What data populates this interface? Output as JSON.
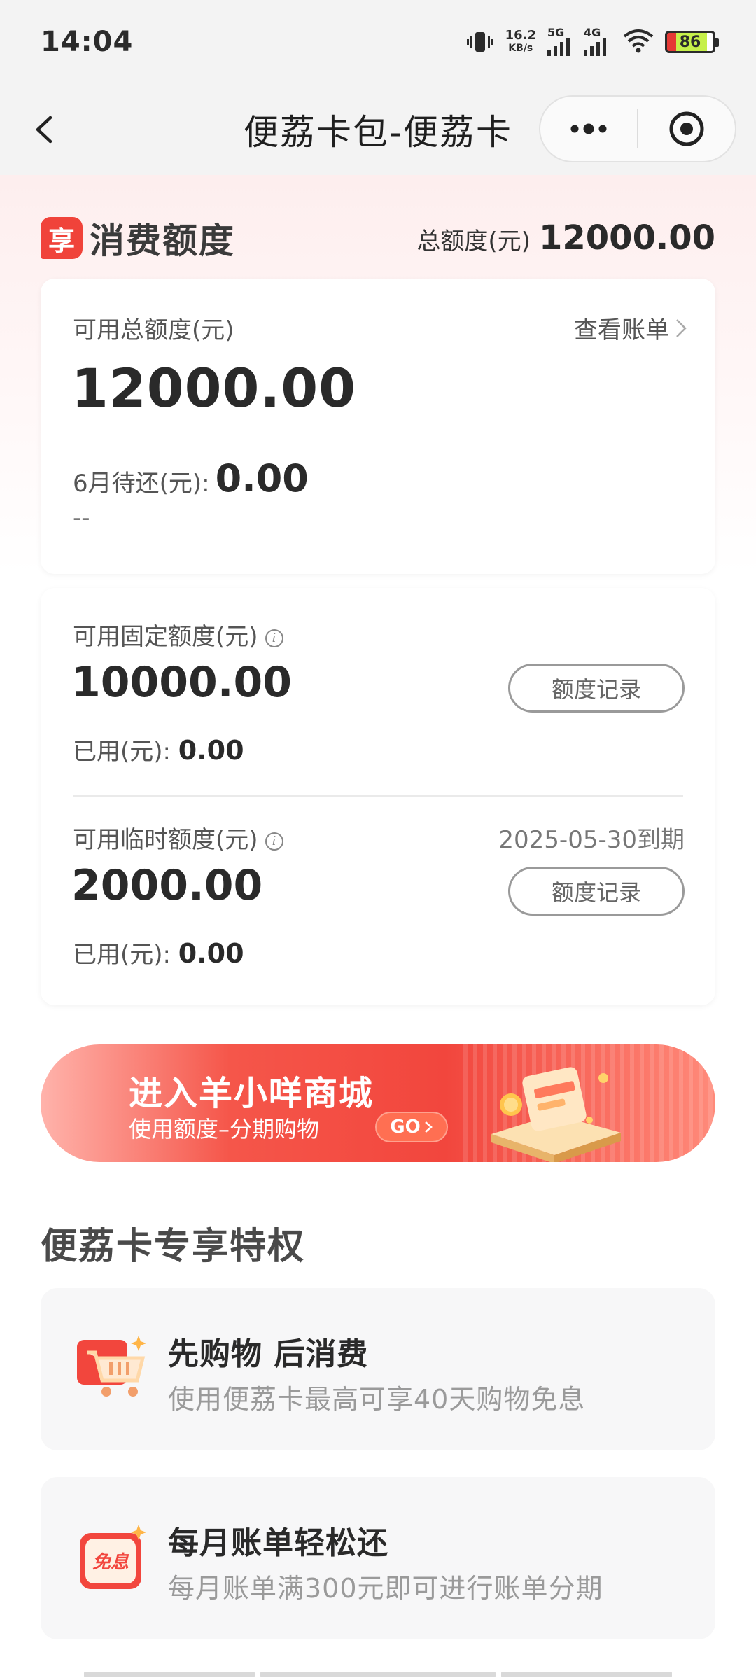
{
  "status": {
    "time": "14:04",
    "net_speed_top": "16.2",
    "net_speed_bottom": "KB/s",
    "sig1_label": "5G",
    "sig2_label": "4G",
    "battery": "86"
  },
  "nav": {
    "title": "便荔卡包-便荔卡",
    "icons": {
      "back": "chevron-left-icon",
      "more": "more-dots-icon",
      "close": "target-icon"
    }
  },
  "quota": {
    "logo": "享",
    "title": "消费额度",
    "total_label": "总额度(元)",
    "total_value": "12000.00"
  },
  "card1": {
    "available_label": "可用总额度(元)",
    "available_value": "12000.00",
    "bill_link": "查看账单",
    "due_label": "6月待还(元):",
    "due_value": "0.00",
    "due_sub": "--"
  },
  "fixed": {
    "label": "可用固定额度(元)",
    "value": "10000.00",
    "record_btn": "额度记录",
    "used_label": "已用(元):",
    "used_value": "0.00"
  },
  "temp": {
    "label": "可用临时额度(元)",
    "value": "2000.00",
    "expire": "2025-05-30到期",
    "record_btn": "额度记录",
    "used_label": "已用(元):",
    "used_value": "0.00"
  },
  "banner": {
    "title": "进入羊小咩商城",
    "subtitle": "使用额度–分期购物",
    "go": "GO"
  },
  "privileges": {
    "title": "便荔卡专享特权",
    "items": [
      {
        "title": "先购物 后消费",
        "desc": "使用便荔卡最高可享40天购物免息",
        "icon": "shopping-cart-icon"
      },
      {
        "title": "每月账单轻松还",
        "desc": "每月账单满300元即可进行账单分期",
        "icon": "interest-free-icon",
        "icon_text": "免息"
      }
    ]
  },
  "colors": {
    "accent": "#f0433a",
    "banner": "#f2463d"
  }
}
